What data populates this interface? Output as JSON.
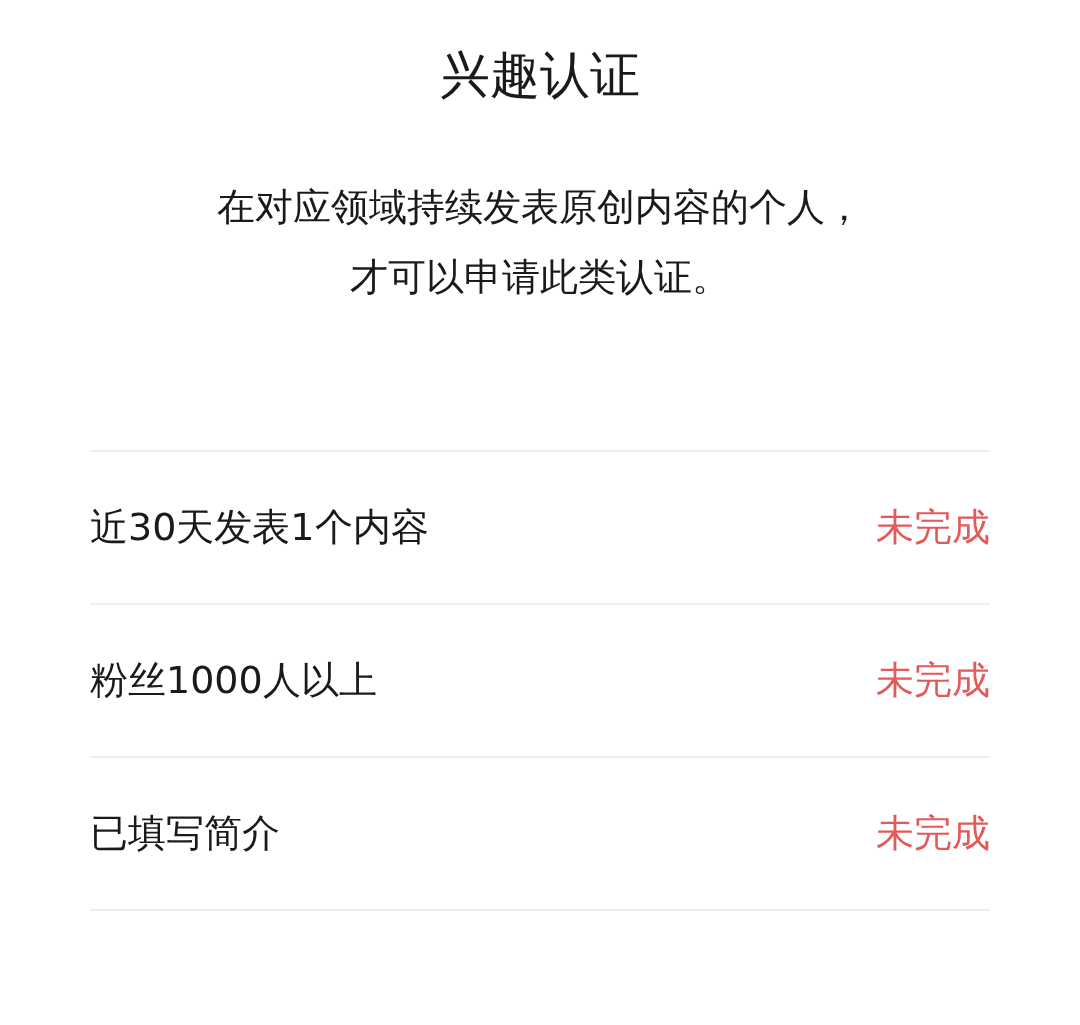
{
  "title": "兴趣认证",
  "description": [
    "在对应领域持续发表原创内容的个人，",
    "才可以申请此类认证。"
  ],
  "requirements": [
    {
      "label": "近30天发表1个内容",
      "status": "未完成",
      "done": false
    },
    {
      "label": "粉丝1000人以上",
      "status": "未完成",
      "done": false
    },
    {
      "label": "已填写简介",
      "status": "未完成",
      "done": false
    }
  ]
}
